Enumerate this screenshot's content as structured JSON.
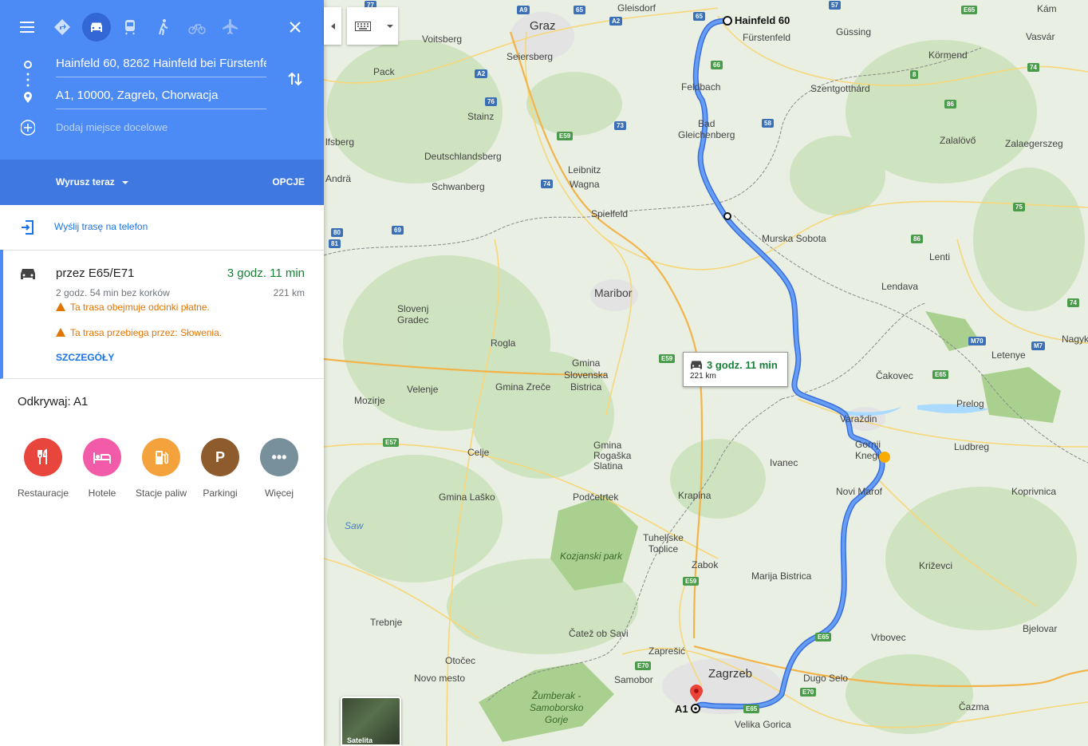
{
  "header": {
    "modes": [
      {
        "name": "best-travel-mode",
        "icon": "directions-icon"
      },
      {
        "name": "driving",
        "icon": "car-icon",
        "active": true
      },
      {
        "name": "transit",
        "icon": "train-icon"
      },
      {
        "name": "walking",
        "icon": "walk-icon"
      },
      {
        "name": "cycling",
        "icon": "bike-icon"
      },
      {
        "name": "flights",
        "icon": "plane-icon"
      }
    ],
    "origin": "Hainfeld 60, 8262 Hainfeld bei Fürstenfeld",
    "destination": "A1, 10000, Zagreb, Chorwacja",
    "add_destination": "Dodaj miejsce docelowe"
  },
  "depart": {
    "label": "Wyrusz teraz",
    "options": "OPCJE"
  },
  "send_to_phone": "Wyślij trasę na telefon",
  "route": {
    "via": "przez E65/E71",
    "time": "3 godz. 11 min",
    "no_traffic": "2 godz. 54 min bez korków",
    "distance": "221 km",
    "warning_tolls": "Ta trasa obejmuje odcinki płatne.",
    "warning_country": "Ta trasa przebiega przez: Słowenia.",
    "details": "SZCZEGÓŁY"
  },
  "explore": {
    "title": "Odkrywaj: A1",
    "categories": [
      {
        "label": "Restauracje",
        "icon": "restaurant-icon",
        "color": "#e8453c"
      },
      {
        "label": "Hotele",
        "icon": "hotel-icon",
        "color": "#f25ba8"
      },
      {
        "label": "Stacje paliw",
        "icon": "gas-station-icon",
        "color": "#f4a33c"
      },
      {
        "label": "Parkingi",
        "icon": "parking-icon",
        "color": "#8d5b2c"
      },
      {
        "label": "Więcej",
        "icon": "more-icon",
        "color": "#78909c"
      }
    ]
  },
  "map": {
    "callout": {
      "time": "3 godz. 11 min",
      "distance": "221 km"
    },
    "origin_label": "Hainfeld 60",
    "destination_label": "A1",
    "satellite_label": "Satelita",
    "places": {
      "graz": "Graz",
      "gleisdorf": "Gleisdorf",
      "voitsberg": "Voitsberg",
      "seiersberg": "Seiersberg",
      "furstenfeld": "Fürstenfeld",
      "gussing": "Güssing",
      "kam": "Kám",
      "vasvar": "Vasvár",
      "kormend": "Körmend",
      "pack": "Pack",
      "feldbach": "Feldbach",
      "szentgotthard": "Szentgotthárd",
      "stainz": "Stainz",
      "bad_gleichenberg": "Bad\nGleichenberg",
      "zalalovo": "Zalalövő",
      "zalaegerszeg": "Zalaegerszeg",
      "lfsberg": "lfsberg",
      "deutschlandsberg": "Deutschlandsberg",
      "leibnitz": "Leibnitz",
      "wagna": "Wagna",
      "andra": "Andrä",
      "schwanberg": "Schwanberg",
      "spielfeld": "Spielfeld",
      "murska_sobota": "Murska Sobota",
      "lenti": "Lenti",
      "lendava": "Lendava",
      "maribor": "Maribor",
      "slovenj_gradec": "Slovenj\nGradec",
      "rogla": "Rogla",
      "gmina_slovenska_bistrica": "Gmina\nSlovenska\nBistrica",
      "gmina_zrece": "Gmina Zreče",
      "letenye": "Letenye",
      "nagyk": "Nagyk",
      "cakovec": "Čakovec",
      "prelog": "Prelog",
      "mozirje": "Mozirje",
      "velenje": "Velenje",
      "varazdin": "Varaždin",
      "gornji_knegi": "Gornji\nKnegi",
      "ludbreg": "Ludbreg",
      "celje": "Celje",
      "gmina_rogaska_slatina": "Gmina\nRogaška\nSlatina",
      "ivanec": "Ivanec",
      "novi_marof": "Novi Marof",
      "koprivnica": "Koprivnica",
      "gmina_lasko": "Gmina Laško",
      "podcetrtek": "Podčetrtek",
      "krapina": "Krapina",
      "saw": "Saw",
      "tuheljske_toplice": "Tuheljske\nToplice",
      "kozjanski_park": "Kozjanski park",
      "zabok": "Zabok",
      "marija_bistrica": "Marija Bistrica",
      "krizevci": "Križevci",
      "trebnje": "Trebnje",
      "catez": "Čatež ob Savi",
      "zapresic": "Zaprešić",
      "vrbovec": "Vrbovec",
      "bjelovar": "Bjelovar",
      "otocec": "Otočec",
      "zagrzeb": "Zagrzeb",
      "dugo_selo": "Dugo Selo",
      "novo_mesto": "Novo mesto",
      "samobor": "Samobor",
      "zumberak": "Žumberak -\nSamoborsko\nGorje",
      "velika_gorica": "Velika Gorica",
      "cazma": "Čazma"
    },
    "roads": [
      "77",
      "A9",
      "65",
      "A2",
      "65",
      "57",
      "E65",
      "A2",
      "66",
      "8",
      "74",
      "76",
      "58",
      "86",
      "73",
      "E59",
      "74",
      "75",
      "69",
      "80",
      "81",
      "86",
      "74",
      "M70",
      "M7",
      "E59",
      "E65",
      "E57",
      "E59",
      "E70",
      "E65",
      "E70",
      "E65"
    ]
  }
}
